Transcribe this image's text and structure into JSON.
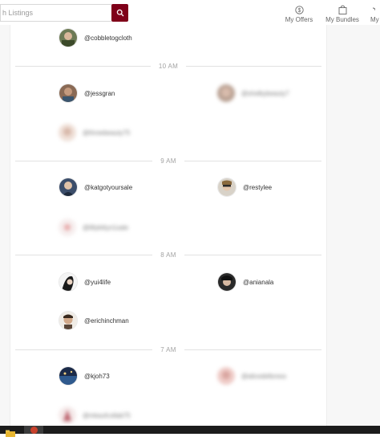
{
  "header": {
    "search_placeholder": "h Listings",
    "nav": [
      {
        "label": "My Offers",
        "icon": "dollar-circle-icon"
      },
      {
        "label": "My Bundles",
        "icon": "bag-icon"
      },
      {
        "label": "My",
        "icon": "partial-icon"
      }
    ]
  },
  "feed": {
    "sections": [
      {
        "time": "",
        "users": [
          {
            "handle": "@cobbletogcloth",
            "blurred": false
          }
        ]
      },
      {
        "time": "10 AM",
        "users": [
          {
            "handle": "@jessgran",
            "blurred": false
          },
          {
            "handle": "@shelbybeauty7",
            "blurred": true
          },
          {
            "handle": "@threebeauty75",
            "blurred": true
          }
        ]
      },
      {
        "time": "9 AM",
        "users": [
          {
            "handle": "@katgotyoursale",
            "blurred": false
          },
          {
            "handle": "@restylee",
            "blurred": false
          },
          {
            "handle": "@lillykittyn1sale",
            "blurred": true
          }
        ]
      },
      {
        "time": "8 AM",
        "users": [
          {
            "handle": "@yui4life",
            "blurred": false
          },
          {
            "handle": "@anianala",
            "blurred": false
          },
          {
            "handle": "@erichinchman",
            "blurred": false
          }
        ]
      },
      {
        "time": "7 AM",
        "users": [
          {
            "handle": "@kjoh73",
            "blurred": false
          },
          {
            "handle": "@alicedellsress",
            "blurred": true
          },
          {
            "handle": "@mkaufcollab75",
            "blurred": true
          }
        ]
      }
    ]
  },
  "colors": {
    "accent": "#7f0019",
    "divider": "#e2e2e2",
    "text": "#333333",
    "muted": "#a3a3a3"
  }
}
